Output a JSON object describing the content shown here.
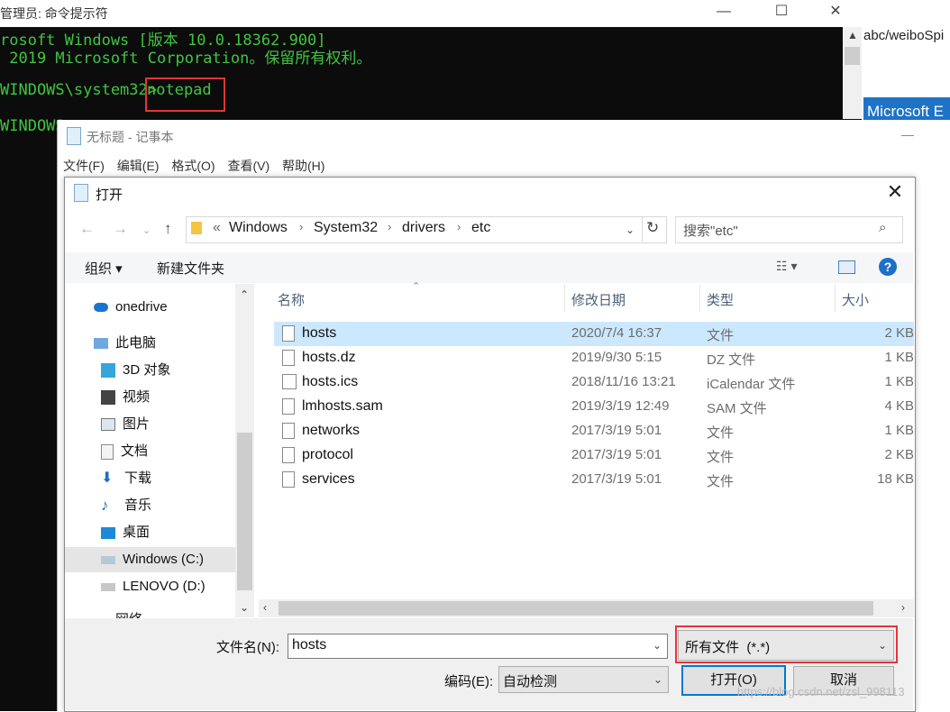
{
  "console": {
    "title": "管理员: 命令提示符",
    "lines": [
      "rosoft Windows [版本 10.0.18362.900]",
      " 2019 Microsoft Corporation。保留所有权利。",
      "WINDOWS\\system32>",
      "WINDOWS"
    ],
    "command": "notepad",
    "buttons": {
      "minimize": "—",
      "maximize": "☐",
      "close": "✕"
    }
  },
  "browser": {
    "address_fragment": "abc/weiboSpi",
    "band_text": "Microsoft E"
  },
  "notepad": {
    "title": "无标题 - 记事本",
    "menu": [
      "文件(F)",
      "编辑(E)",
      "格式(O)",
      "查看(V)",
      "帮助(H)"
    ]
  },
  "dialog": {
    "title": "打开",
    "breadcrumb": {
      "prefix": "«",
      "parts": [
        "Windows",
        "System32",
        "drivers",
        "etc"
      ]
    },
    "search_placeholder": "搜索\"etc\"",
    "toolbar": {
      "organize": "组织 ▾",
      "new_folder": "新建文件夹"
    },
    "nav": [
      {
        "label": "onedrive",
        "icon": "cloud-icon"
      },
      {
        "label": "此电脑",
        "icon": "computer-icon"
      },
      {
        "label": "3D 对象",
        "icon": "cube-icon"
      },
      {
        "label": "视频",
        "icon": "video-icon"
      },
      {
        "label": "图片",
        "icon": "picture-icon"
      },
      {
        "label": "文档",
        "icon": "document-icon"
      },
      {
        "label": "下载",
        "icon": "download-icon"
      },
      {
        "label": "音乐",
        "icon": "music-icon"
      },
      {
        "label": "桌面",
        "icon": "desktop-icon"
      },
      {
        "label": "Windows (C:)",
        "icon": "drive-icon"
      },
      {
        "label": "LENOVO (D:)",
        "icon": "drive-icon"
      },
      {
        "label": "网络",
        "icon": "network-icon"
      }
    ],
    "columns": [
      "名称",
      "修改日期",
      "类型",
      "大小"
    ],
    "files": [
      {
        "name": "hosts",
        "date": "2020/7/4 16:37",
        "type": "文件",
        "size": "2 KB"
      },
      {
        "name": "hosts.dz",
        "date": "2019/9/30 5:15",
        "type": "DZ 文件",
        "size": "1 KB"
      },
      {
        "name": "hosts.ics",
        "date": "2018/11/16 13:21",
        "type": "iCalendar 文件",
        "size": "1 KB"
      },
      {
        "name": "lmhosts.sam",
        "date": "2019/3/19 12:49",
        "type": "SAM 文件",
        "size": "4 KB"
      },
      {
        "name": "networks",
        "date": "2017/3/19 5:01",
        "type": "文件",
        "size": "1 KB"
      },
      {
        "name": "protocol",
        "date": "2017/3/19 5:01",
        "type": "文件",
        "size": "2 KB"
      },
      {
        "name": "services",
        "date": "2017/3/19 5:01",
        "type": "文件",
        "size": "18 KB"
      }
    ],
    "filename_label": "文件名(N):",
    "filename_value": "hosts",
    "filetype_value": "所有文件  (*.*)",
    "encoding_label": "编码(E):",
    "encoding_value": "自动检测",
    "open_button": "打开(O)",
    "cancel_button": "取消"
  },
  "watermark": "https://blog.csdn.net/zsl_998113",
  "colors": {
    "console_text": "#3fc63f",
    "highlight_box": "#e8333a",
    "selection": "#cce8ff",
    "accent": "#0078d7"
  }
}
